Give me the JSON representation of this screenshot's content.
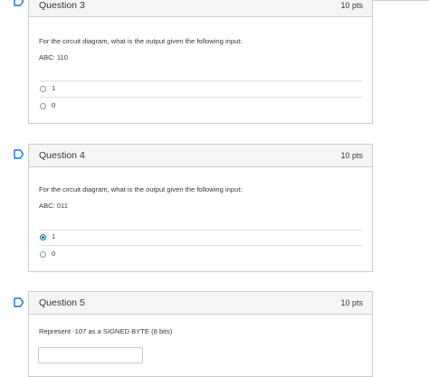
{
  "questions": [
    {
      "title": "Question 3",
      "points": "10 pts",
      "prompt": "For the circuit diagram, what is the output given the following input:",
      "input": "ABC: 110",
      "answers": [
        {
          "label": "1",
          "selected": false
        },
        {
          "label": "0",
          "selected": false
        }
      ]
    },
    {
      "title": "Question 4",
      "points": "10 pts",
      "prompt": "For the circuit diagram, what is the output given the following input:",
      "input": "ABC: 011",
      "answers": [
        {
          "label": "1",
          "selected": true
        },
        {
          "label": "0",
          "selected": false
        }
      ]
    },
    {
      "title": "Question 5",
      "points": "10 pts",
      "prompt": "Represent -107 as a SIGNED BYTE (8 bits)",
      "answer_value": ""
    }
  ],
  "colors": {
    "flag": "#1a73d9",
    "header_bg": "#f5f5f5",
    "border": "#c7cdd1",
    "selected_radio": "#0770a3"
  },
  "icons": {
    "flag": "bookmark-flag-icon"
  }
}
